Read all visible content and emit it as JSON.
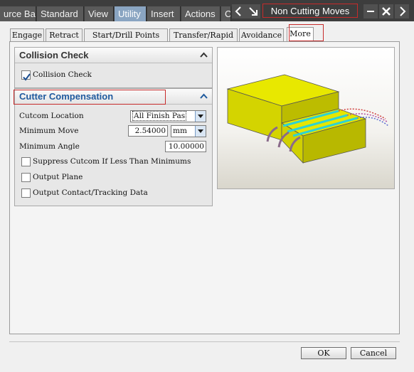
{
  "menubar": {
    "items": [
      "urce Bar",
      "Standard",
      "View",
      "Utility",
      "Insert",
      "Actions",
      "C"
    ],
    "active": "Utility"
  },
  "window": {
    "title": "Non Cutting Moves"
  },
  "tabs": [
    "Engage",
    "Retract",
    "Start/Drill Points",
    "Transfer/Rapid",
    "Avoidance",
    "More"
  ],
  "active_tab": "More",
  "collision_check": {
    "title": "Collision Check",
    "checkbox_label": "Collision Check",
    "checked": true
  },
  "cutter_compensation": {
    "title": "Cutter Compensation",
    "cutcom_location_label": "Cutcom Location",
    "cutcom_location_value": "All Finish Pas",
    "minimum_move_label": "Minimum Move",
    "minimum_move_value": "2.54000",
    "minimum_move_unit": "mm",
    "minimum_angle_label": "Minimum Angle",
    "minimum_angle_value": "10.00000",
    "suppress_label": "Suppress Cutcom If Less Than Minimums",
    "output_plane_label": "Output Plane",
    "output_contact_label": "Output Contact/Tracking Data"
  },
  "buttons": {
    "ok": "OK",
    "cancel": "Cancel"
  },
  "colors": {
    "accent_red": "#c72b2b",
    "section_blue": "#1f5a9e",
    "part_yellow": "#e6e600"
  }
}
